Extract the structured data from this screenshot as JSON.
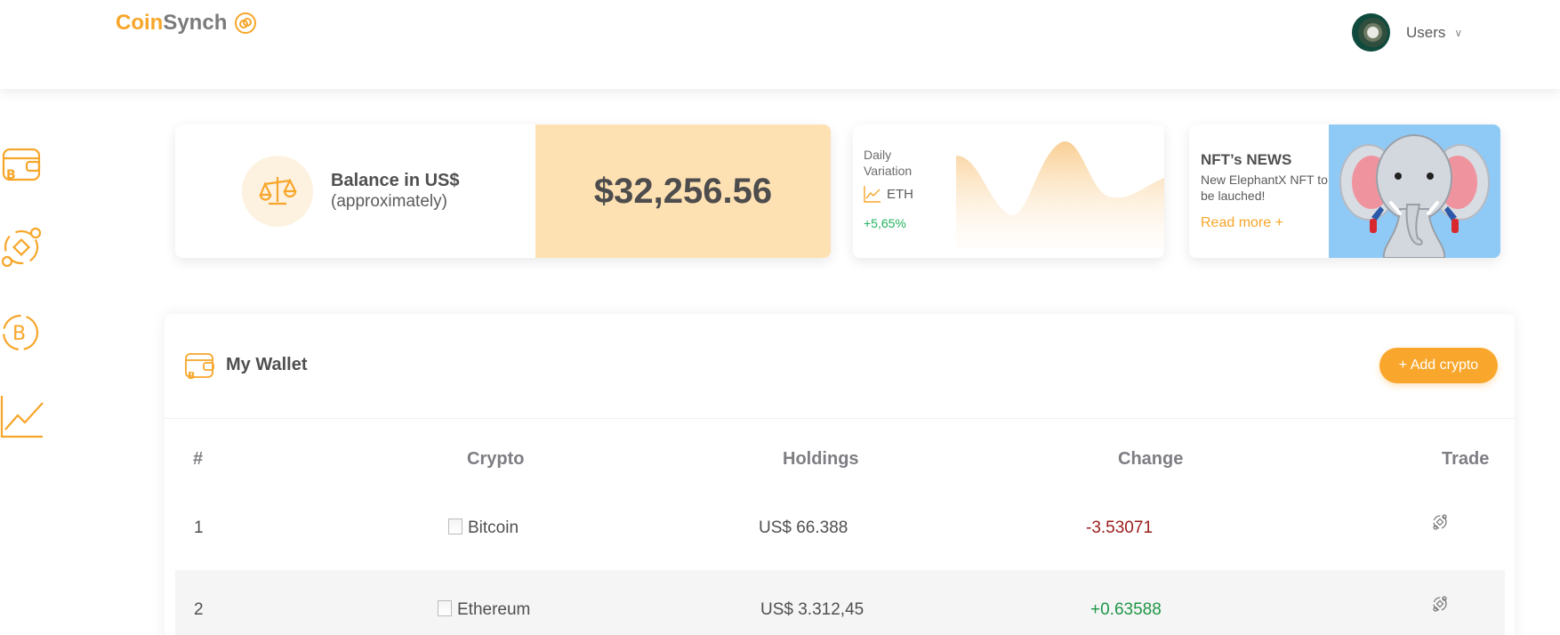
{
  "header": {
    "logo_part1": "Coin",
    "logo_part2": "Synch",
    "user_label": "Users"
  },
  "sidebar": {
    "items": [
      {
        "icon": "wallet-icon"
      },
      {
        "icon": "exchange-icon"
      },
      {
        "icon": "bitcoin-icon"
      },
      {
        "icon": "chart-line-icon"
      }
    ]
  },
  "balance": {
    "title": "Balance in US$",
    "subtitle": "(approximately)",
    "value": "$32,256.56"
  },
  "daily_variation": {
    "title": "Daily Variation",
    "coin": "ETH",
    "change": "+5,65%"
  },
  "nft_news": {
    "title": "NFT’s NEWS",
    "description": "New ElephantX NFT to be lauched!",
    "link": "Read more +"
  },
  "wallet": {
    "title": "My Wallet",
    "add_button": "+ Add crypto",
    "columns": [
      "#",
      "Crypto",
      "Holdings",
      "Change",
      "Trade"
    ],
    "rows": [
      {
        "index": "1",
        "crypto": "Bitcoin",
        "holdings": "US$ 66.388",
        "change": "-3.53071"
      },
      {
        "index": "2",
        "crypto": "Ethereum",
        "holdings": "US$ 3.312,45",
        "change": "+0.63588"
      }
    ]
  },
  "colors": {
    "accent": "#f7a62a",
    "balance_bg": "#fee1b3",
    "negative": "#9b1c1c",
    "positive": "#1e9647"
  }
}
